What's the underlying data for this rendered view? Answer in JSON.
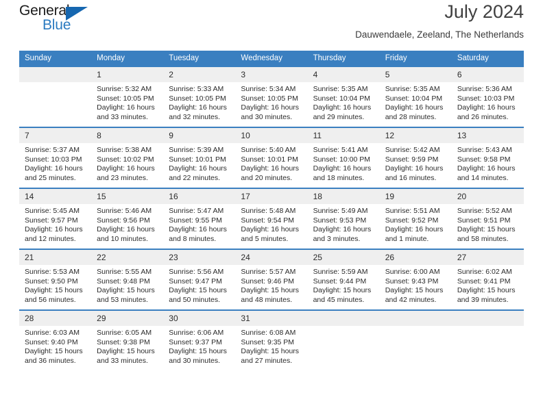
{
  "logo": {
    "word_one": "General",
    "word_two": "Blue",
    "triangle_icon": "blue-triangle-icon",
    "colors": {
      "dark": "#1b1b1b",
      "blue": "#2a7ac0",
      "triangle": "#1667b0"
    }
  },
  "header": {
    "title": "July 2024",
    "subtitle": "Dauwendaele, Zeeland, The Netherlands"
  },
  "theme": {
    "header_blue": "#3a7fc0",
    "daynum_band": "#efefef",
    "text": "#2b2b2b"
  },
  "calendar": {
    "weekday_headers": [
      "Sunday",
      "Monday",
      "Tuesday",
      "Wednesday",
      "Thursday",
      "Friday",
      "Saturday"
    ],
    "weeks": [
      [
        {
          "day": "",
          "sunrise": "",
          "sunset": "",
          "daylight_1": "",
          "daylight_2": ""
        },
        {
          "day": "1",
          "sunrise": "Sunrise: 5:32 AM",
          "sunset": "Sunset: 10:05 PM",
          "daylight_1": "Daylight: 16 hours",
          "daylight_2": "and 33 minutes."
        },
        {
          "day": "2",
          "sunrise": "Sunrise: 5:33 AM",
          "sunset": "Sunset: 10:05 PM",
          "daylight_1": "Daylight: 16 hours",
          "daylight_2": "and 32 minutes."
        },
        {
          "day": "3",
          "sunrise": "Sunrise: 5:34 AM",
          "sunset": "Sunset: 10:05 PM",
          "daylight_1": "Daylight: 16 hours",
          "daylight_2": "and 30 minutes."
        },
        {
          "day": "4",
          "sunrise": "Sunrise: 5:35 AM",
          "sunset": "Sunset: 10:04 PM",
          "daylight_1": "Daylight: 16 hours",
          "daylight_2": "and 29 minutes."
        },
        {
          "day": "5",
          "sunrise": "Sunrise: 5:35 AM",
          "sunset": "Sunset: 10:04 PM",
          "daylight_1": "Daylight: 16 hours",
          "daylight_2": "and 28 minutes."
        },
        {
          "day": "6",
          "sunrise": "Sunrise: 5:36 AM",
          "sunset": "Sunset: 10:03 PM",
          "daylight_1": "Daylight: 16 hours",
          "daylight_2": "and 26 minutes."
        }
      ],
      [
        {
          "day": "7",
          "sunrise": "Sunrise: 5:37 AM",
          "sunset": "Sunset: 10:03 PM",
          "daylight_1": "Daylight: 16 hours",
          "daylight_2": "and 25 minutes."
        },
        {
          "day": "8",
          "sunrise": "Sunrise: 5:38 AM",
          "sunset": "Sunset: 10:02 PM",
          "daylight_1": "Daylight: 16 hours",
          "daylight_2": "and 23 minutes."
        },
        {
          "day": "9",
          "sunrise": "Sunrise: 5:39 AM",
          "sunset": "Sunset: 10:01 PM",
          "daylight_1": "Daylight: 16 hours",
          "daylight_2": "and 22 minutes."
        },
        {
          "day": "10",
          "sunrise": "Sunrise: 5:40 AM",
          "sunset": "Sunset: 10:01 PM",
          "daylight_1": "Daylight: 16 hours",
          "daylight_2": "and 20 minutes."
        },
        {
          "day": "11",
          "sunrise": "Sunrise: 5:41 AM",
          "sunset": "Sunset: 10:00 PM",
          "daylight_1": "Daylight: 16 hours",
          "daylight_2": "and 18 minutes."
        },
        {
          "day": "12",
          "sunrise": "Sunrise: 5:42 AM",
          "sunset": "Sunset: 9:59 PM",
          "daylight_1": "Daylight: 16 hours",
          "daylight_2": "and 16 minutes."
        },
        {
          "day": "13",
          "sunrise": "Sunrise: 5:43 AM",
          "sunset": "Sunset: 9:58 PM",
          "daylight_1": "Daylight: 16 hours",
          "daylight_2": "and 14 minutes."
        }
      ],
      [
        {
          "day": "14",
          "sunrise": "Sunrise: 5:45 AM",
          "sunset": "Sunset: 9:57 PM",
          "daylight_1": "Daylight: 16 hours",
          "daylight_2": "and 12 minutes."
        },
        {
          "day": "15",
          "sunrise": "Sunrise: 5:46 AM",
          "sunset": "Sunset: 9:56 PM",
          "daylight_1": "Daylight: 16 hours",
          "daylight_2": "and 10 minutes."
        },
        {
          "day": "16",
          "sunrise": "Sunrise: 5:47 AM",
          "sunset": "Sunset: 9:55 PM",
          "daylight_1": "Daylight: 16 hours",
          "daylight_2": "and 8 minutes."
        },
        {
          "day": "17",
          "sunrise": "Sunrise: 5:48 AM",
          "sunset": "Sunset: 9:54 PM",
          "daylight_1": "Daylight: 16 hours",
          "daylight_2": "and 5 minutes."
        },
        {
          "day": "18",
          "sunrise": "Sunrise: 5:49 AM",
          "sunset": "Sunset: 9:53 PM",
          "daylight_1": "Daylight: 16 hours",
          "daylight_2": "and 3 minutes."
        },
        {
          "day": "19",
          "sunrise": "Sunrise: 5:51 AM",
          "sunset": "Sunset: 9:52 PM",
          "daylight_1": "Daylight: 16 hours",
          "daylight_2": "and 1 minute."
        },
        {
          "day": "20",
          "sunrise": "Sunrise: 5:52 AM",
          "sunset": "Sunset: 9:51 PM",
          "daylight_1": "Daylight: 15 hours",
          "daylight_2": "and 58 minutes."
        }
      ],
      [
        {
          "day": "21",
          "sunrise": "Sunrise: 5:53 AM",
          "sunset": "Sunset: 9:50 PM",
          "daylight_1": "Daylight: 15 hours",
          "daylight_2": "and 56 minutes."
        },
        {
          "day": "22",
          "sunrise": "Sunrise: 5:55 AM",
          "sunset": "Sunset: 9:48 PM",
          "daylight_1": "Daylight: 15 hours",
          "daylight_2": "and 53 minutes."
        },
        {
          "day": "23",
          "sunrise": "Sunrise: 5:56 AM",
          "sunset": "Sunset: 9:47 PM",
          "daylight_1": "Daylight: 15 hours",
          "daylight_2": "and 50 minutes."
        },
        {
          "day": "24",
          "sunrise": "Sunrise: 5:57 AM",
          "sunset": "Sunset: 9:46 PM",
          "daylight_1": "Daylight: 15 hours",
          "daylight_2": "and 48 minutes."
        },
        {
          "day": "25",
          "sunrise": "Sunrise: 5:59 AM",
          "sunset": "Sunset: 9:44 PM",
          "daylight_1": "Daylight: 15 hours",
          "daylight_2": "and 45 minutes."
        },
        {
          "day": "26",
          "sunrise": "Sunrise: 6:00 AM",
          "sunset": "Sunset: 9:43 PM",
          "daylight_1": "Daylight: 15 hours",
          "daylight_2": "and 42 minutes."
        },
        {
          "day": "27",
          "sunrise": "Sunrise: 6:02 AM",
          "sunset": "Sunset: 9:41 PM",
          "daylight_1": "Daylight: 15 hours",
          "daylight_2": "and 39 minutes."
        }
      ],
      [
        {
          "day": "28",
          "sunrise": "Sunrise: 6:03 AM",
          "sunset": "Sunset: 9:40 PM",
          "daylight_1": "Daylight: 15 hours",
          "daylight_2": "and 36 minutes."
        },
        {
          "day": "29",
          "sunrise": "Sunrise: 6:05 AM",
          "sunset": "Sunset: 9:38 PM",
          "daylight_1": "Daylight: 15 hours",
          "daylight_2": "and 33 minutes."
        },
        {
          "day": "30",
          "sunrise": "Sunrise: 6:06 AM",
          "sunset": "Sunset: 9:37 PM",
          "daylight_1": "Daylight: 15 hours",
          "daylight_2": "and 30 minutes."
        },
        {
          "day": "31",
          "sunrise": "Sunrise: 6:08 AM",
          "sunset": "Sunset: 9:35 PM",
          "daylight_1": "Daylight: 15 hours",
          "daylight_2": "and 27 minutes."
        },
        {
          "day": "",
          "sunrise": "",
          "sunset": "",
          "daylight_1": "",
          "daylight_2": ""
        },
        {
          "day": "",
          "sunrise": "",
          "sunset": "",
          "daylight_1": "",
          "daylight_2": ""
        },
        {
          "day": "",
          "sunrise": "",
          "sunset": "",
          "daylight_1": "",
          "daylight_2": ""
        }
      ]
    ]
  }
}
